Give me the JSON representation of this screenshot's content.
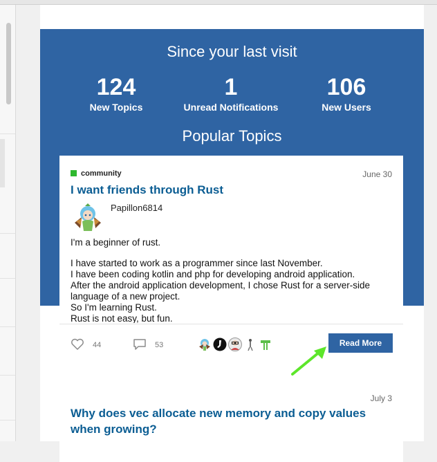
{
  "hero": {
    "title": "Since your last visit",
    "stats": [
      {
        "value": "124",
        "label": "New Topics"
      },
      {
        "value": "1",
        "label": "Unread Notifications"
      },
      {
        "value": "106",
        "label": "New Users"
      }
    ],
    "popular_title": "Popular Topics"
  },
  "topics": [
    {
      "category": "community",
      "category_color": "#2eb82e",
      "date": "June 30",
      "title": "I want friends through Rust",
      "author": "Papillon6814",
      "body": [
        "I'm a beginner of rust.",
        "",
        "I have started to work as a programmer since last November.",
        "I have been coding kotlin and php for developing android application.",
        "After the android application development, I chose Rust for a server-side language of a new project.",
        "So I'm learning Rust.",
        "Rust is not easy, but fun."
      ],
      "likes": "44",
      "replies": "53",
      "read_more": "Read More"
    },
    {
      "date": "July 3",
      "title": "Why does vec allocate new memory and copy values when growing?"
    }
  ],
  "colors": {
    "accent": "#2f64a3",
    "link": "#0b5d93",
    "annotation_arrow": "#5de62b"
  },
  "icons": {
    "like": "heart-icon",
    "reply": "speech-bubble-icon"
  }
}
